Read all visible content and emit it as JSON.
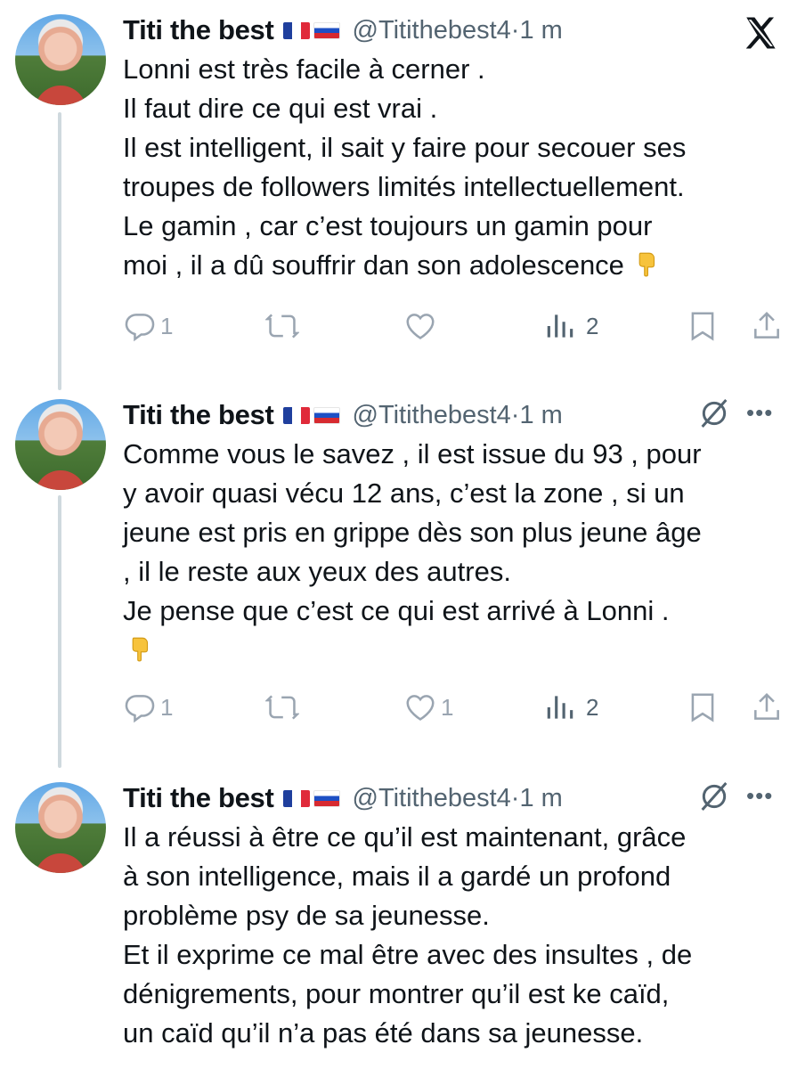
{
  "tweets": [
    {
      "author": {
        "name": "Titi the best",
        "handle": "@Titithebest4",
        "time": "1 m"
      },
      "text_lines": [
        "Lonni est très facile à cerner .",
        "Il faut dire ce qui est vrai .",
        "Il est intelligent, il sait y faire pour secouer ses",
        "troupes de followers limités intellectuellement.",
        "Le gamin , car c’est toujours un gamin pour",
        "moi , il a dû souffrir dan son adolescence"
      ],
      "stats": {
        "replies": "1",
        "reposts": "",
        "likes": "",
        "views": "2"
      }
    },
    {
      "author": {
        "name": "Titi the best",
        "handle": "@Titithebest4",
        "time": "1 m"
      },
      "text_lines": [
        "Comme vous le savez , il est issue du 93 , pour",
        "y avoir quasi vécu 12 ans, c’est la zone , si un",
        "jeune est pris en grippe dès son plus jeune âge",
        ", il le reste aux yeux des autres.",
        "Je pense que c’est ce qui est arrivé à Lonni ."
      ],
      "stats": {
        "replies": "1",
        "reposts": "",
        "likes": "1",
        "views": "2"
      }
    },
    {
      "author": {
        "name": "Titi the best",
        "handle": "@Titithebest4",
        "time": "1 m"
      },
      "text_lines": [
        "Il a réussi à être ce qu’il est maintenant, grâce",
        "à son intelligence, mais il a gardé un profond",
        "problème psy de sa jeunesse.",
        "Et il exprime ce mal être avec des insultes , de",
        "dénigrements, pour montrer qu’il est ke caïd,",
        "un caïd qu’il n’a pas été dans sa jeunesse."
      ]
    }
  ],
  "ui": {
    "separator": "·",
    "more_label": "•••",
    "icons": {
      "reply": "reply-icon",
      "repost": "repost-icon",
      "like": "like-icon",
      "views": "views-icon",
      "bookmark": "bookmark-icon",
      "share": "share-icon",
      "x_logo": "x-logo-icon",
      "grok": "grok-icon",
      "more": "more-icon",
      "emoji": "backhand-index-pointing-down-emoji"
    },
    "colors": {
      "text": "#0f1419",
      "secondary": "#536471",
      "icon": "#8b98a5",
      "thread_line": "#cfd9de"
    }
  }
}
